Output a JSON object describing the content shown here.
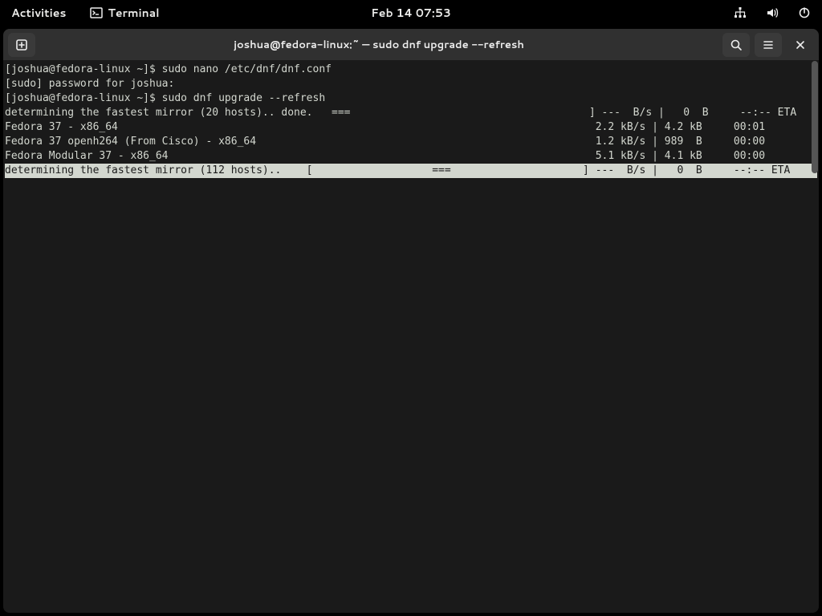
{
  "topbar": {
    "activities": "Activities",
    "app_name": "Terminal",
    "clock": "Feb 14  07:53"
  },
  "window": {
    "title": "joshua@fedora-linux:~ — sudo dnf upgrade --refresh"
  },
  "terminal": {
    "lines": [
      {
        "text": "[joshua@fedora-linux ~]$ sudo nano /etc/dnf/dnf.conf",
        "hl": false
      },
      {
        "text": "[sudo] password for joshua: ",
        "hl": false
      },
      {
        "text": "[joshua@fedora-linux ~]$ sudo dnf upgrade --refresh",
        "hl": false
      },
      {
        "text": "determining the fastest mirror (20 hosts).. done.   ===                                      ] ---  B/s |   0  B     --:-- ETA",
        "hl": false
      },
      {
        "text": "Fedora 37 - x86_64                                                                            2.2 kB/s | 4.2 kB     00:01    ",
        "hl": false
      },
      {
        "text": "Fedora 37 openh264 (From Cisco) - x86_64                                                      1.2 kB/s | 989  B     00:00    ",
        "hl": false
      },
      {
        "text": "Fedora Modular 37 - x86_64                                                                    5.1 kB/s | 4.1 kB     00:00    ",
        "hl": false
      },
      {
        "text": "determining the fastest mirror (112 hosts)..    [                   ===                     ] ---  B/s |   0  B     --:-- ETA",
        "hl": true
      }
    ]
  }
}
